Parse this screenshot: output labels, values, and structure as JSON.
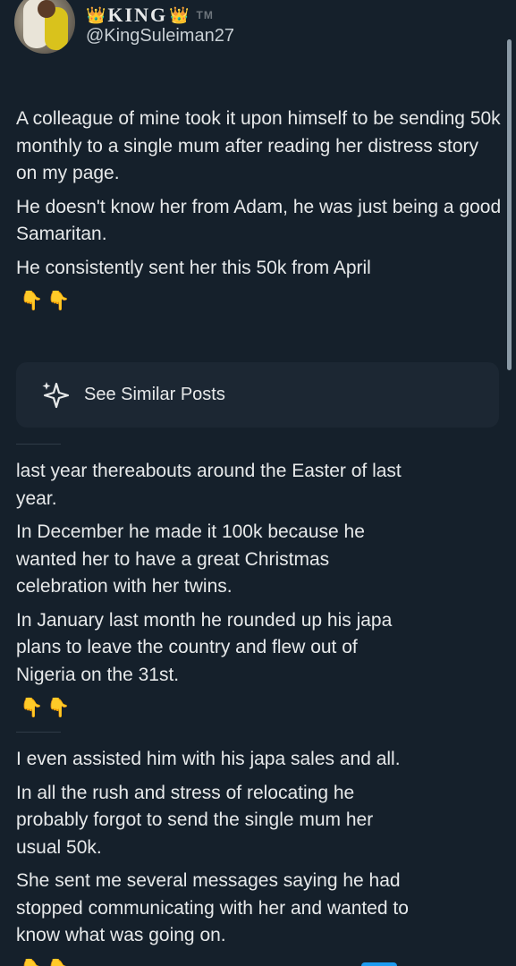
{
  "user": {
    "display_name": "KING",
    "crown_emoji": "👑",
    "tm": "TM",
    "handle": "@KingSuleiman27"
  },
  "post_part1": {
    "paragraphs": [
      "A colleague of mine took it upon himself to be sending 50k monthly to a single mum after reading her distress story on my page.",
      "He doesn't know her from Adam, he was just being a good Samaritan.",
      "He consistently sent her this 50k from April"
    ],
    "emojis": "👇👇"
  },
  "similar_posts": {
    "label": "See Similar Posts",
    "icon": "sparkle-icon"
  },
  "post_part2": {
    "paragraphs": [
      "last year thereabouts around the Easter of last year.",
      "In December he made it 100k because he wanted her to have a great Christmas celebration with her twins.",
      "In January last month he rounded up his japa plans to leave the country and flew out of Nigeria on the 31st."
    ],
    "emojis": "👇👇"
  },
  "post_part3": {
    "paragraphs": [
      "I even assisted him with his japa sales and all.",
      "In all the rush and stress of relocating he probably forgot to send the single mum her usual 50k.",
      "She sent me several messages saying he had stopped communicating with her and wanted to know what was going on."
    ],
    "emojis": "👇👇"
  },
  "colors": {
    "background": "#15202b",
    "card": "#1c2733",
    "text": "#e7e9ea",
    "accent": "#1d9bf0"
  }
}
